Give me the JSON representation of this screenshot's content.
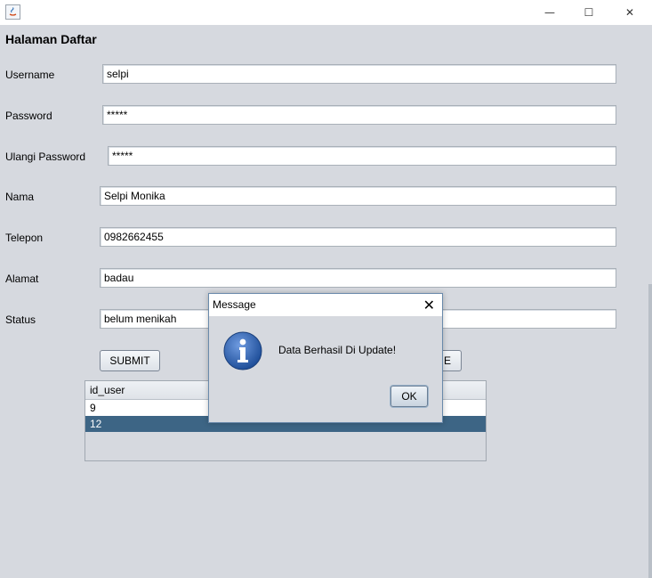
{
  "window": {
    "minimize_glyph": "—",
    "maximize_glyph": "☐",
    "close_glyph": "✕",
    "icon": "java-app-icon"
  },
  "form": {
    "heading": "Halaman Daftar",
    "fields": [
      {
        "label": "Username",
        "value": "selpi"
      },
      {
        "label": "Password",
        "value": "*****"
      },
      {
        "label": "Ulangi Password",
        "value": "*****"
      },
      {
        "label": "Nama",
        "value": "Selpi Monika"
      },
      {
        "label": "Telepon",
        "value": "0982662455"
      },
      {
        "label": "Alamat",
        "value": "badau"
      },
      {
        "label": "Status",
        "value": "belum menikah"
      }
    ],
    "submit_label": "SUBMIT",
    "update_label_visible": "E"
  },
  "table": {
    "column": "id_user",
    "rows": [
      "9",
      "12"
    ],
    "selected_row": "12"
  },
  "dialog": {
    "title": "Message",
    "close_glyph": "✕",
    "message": "Data Berhasil Di Update!",
    "ok_label": "OK",
    "icon": "info-icon"
  },
  "colors": {
    "background": "#d6d9df",
    "selected_row": "#3d6585",
    "info_icon": "#2d5fa8"
  }
}
